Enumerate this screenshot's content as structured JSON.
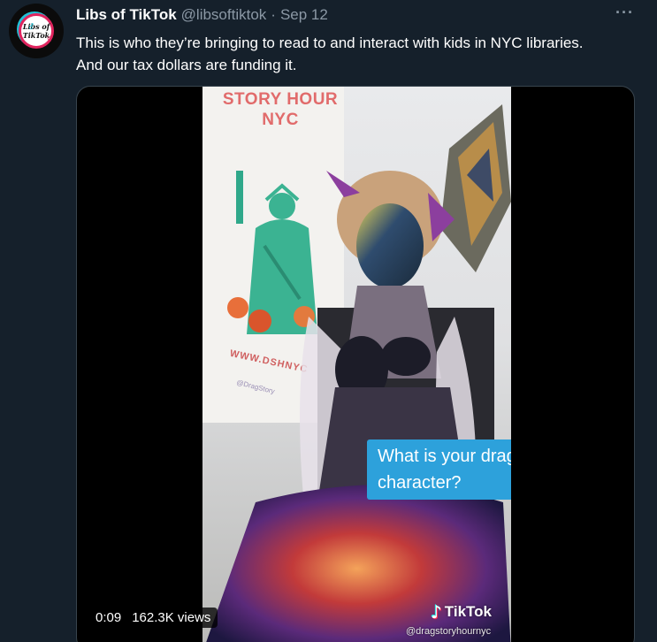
{
  "author": {
    "name": "Libs of TikTok",
    "handle": "@libsoftiktok",
    "separator": "·",
    "date": "Sep 12",
    "avatar_text_line1": "Libs of",
    "avatar_text_line2": "TikTok",
    "avatar_symbol_top": "⚦",
    "avatar_symbol_bottom": "⚥"
  },
  "more_menu": {
    "icon": "more-horizontal-icon",
    "label": "···"
  },
  "tweet": {
    "text": "This is who they’re bringing to read to and interact with kids in NYC libraries. And our tax dollars are funding it."
  },
  "media": {
    "banner_title_line1": "STORY HOUR",
    "banner_title_line2": "NYC",
    "banner_url": "WWW.DSHNYC",
    "banner_handle": "@DragStory",
    "caption_line1": "What is your drag",
    "caption_line2": "character?",
    "tiktok_logo_note": "♪",
    "tiktok_label": "TikTok",
    "tiktok_handle": "@dragstoryhournyc",
    "duration": "0:09",
    "views": "162.3K views"
  },
  "colors": {
    "background": "#15202b",
    "text_primary": "#ffffff",
    "text_secondary": "#8b98a5",
    "border": "#38444d",
    "caption_bg": "#2da1db",
    "banner_red": "#e16b6b"
  }
}
